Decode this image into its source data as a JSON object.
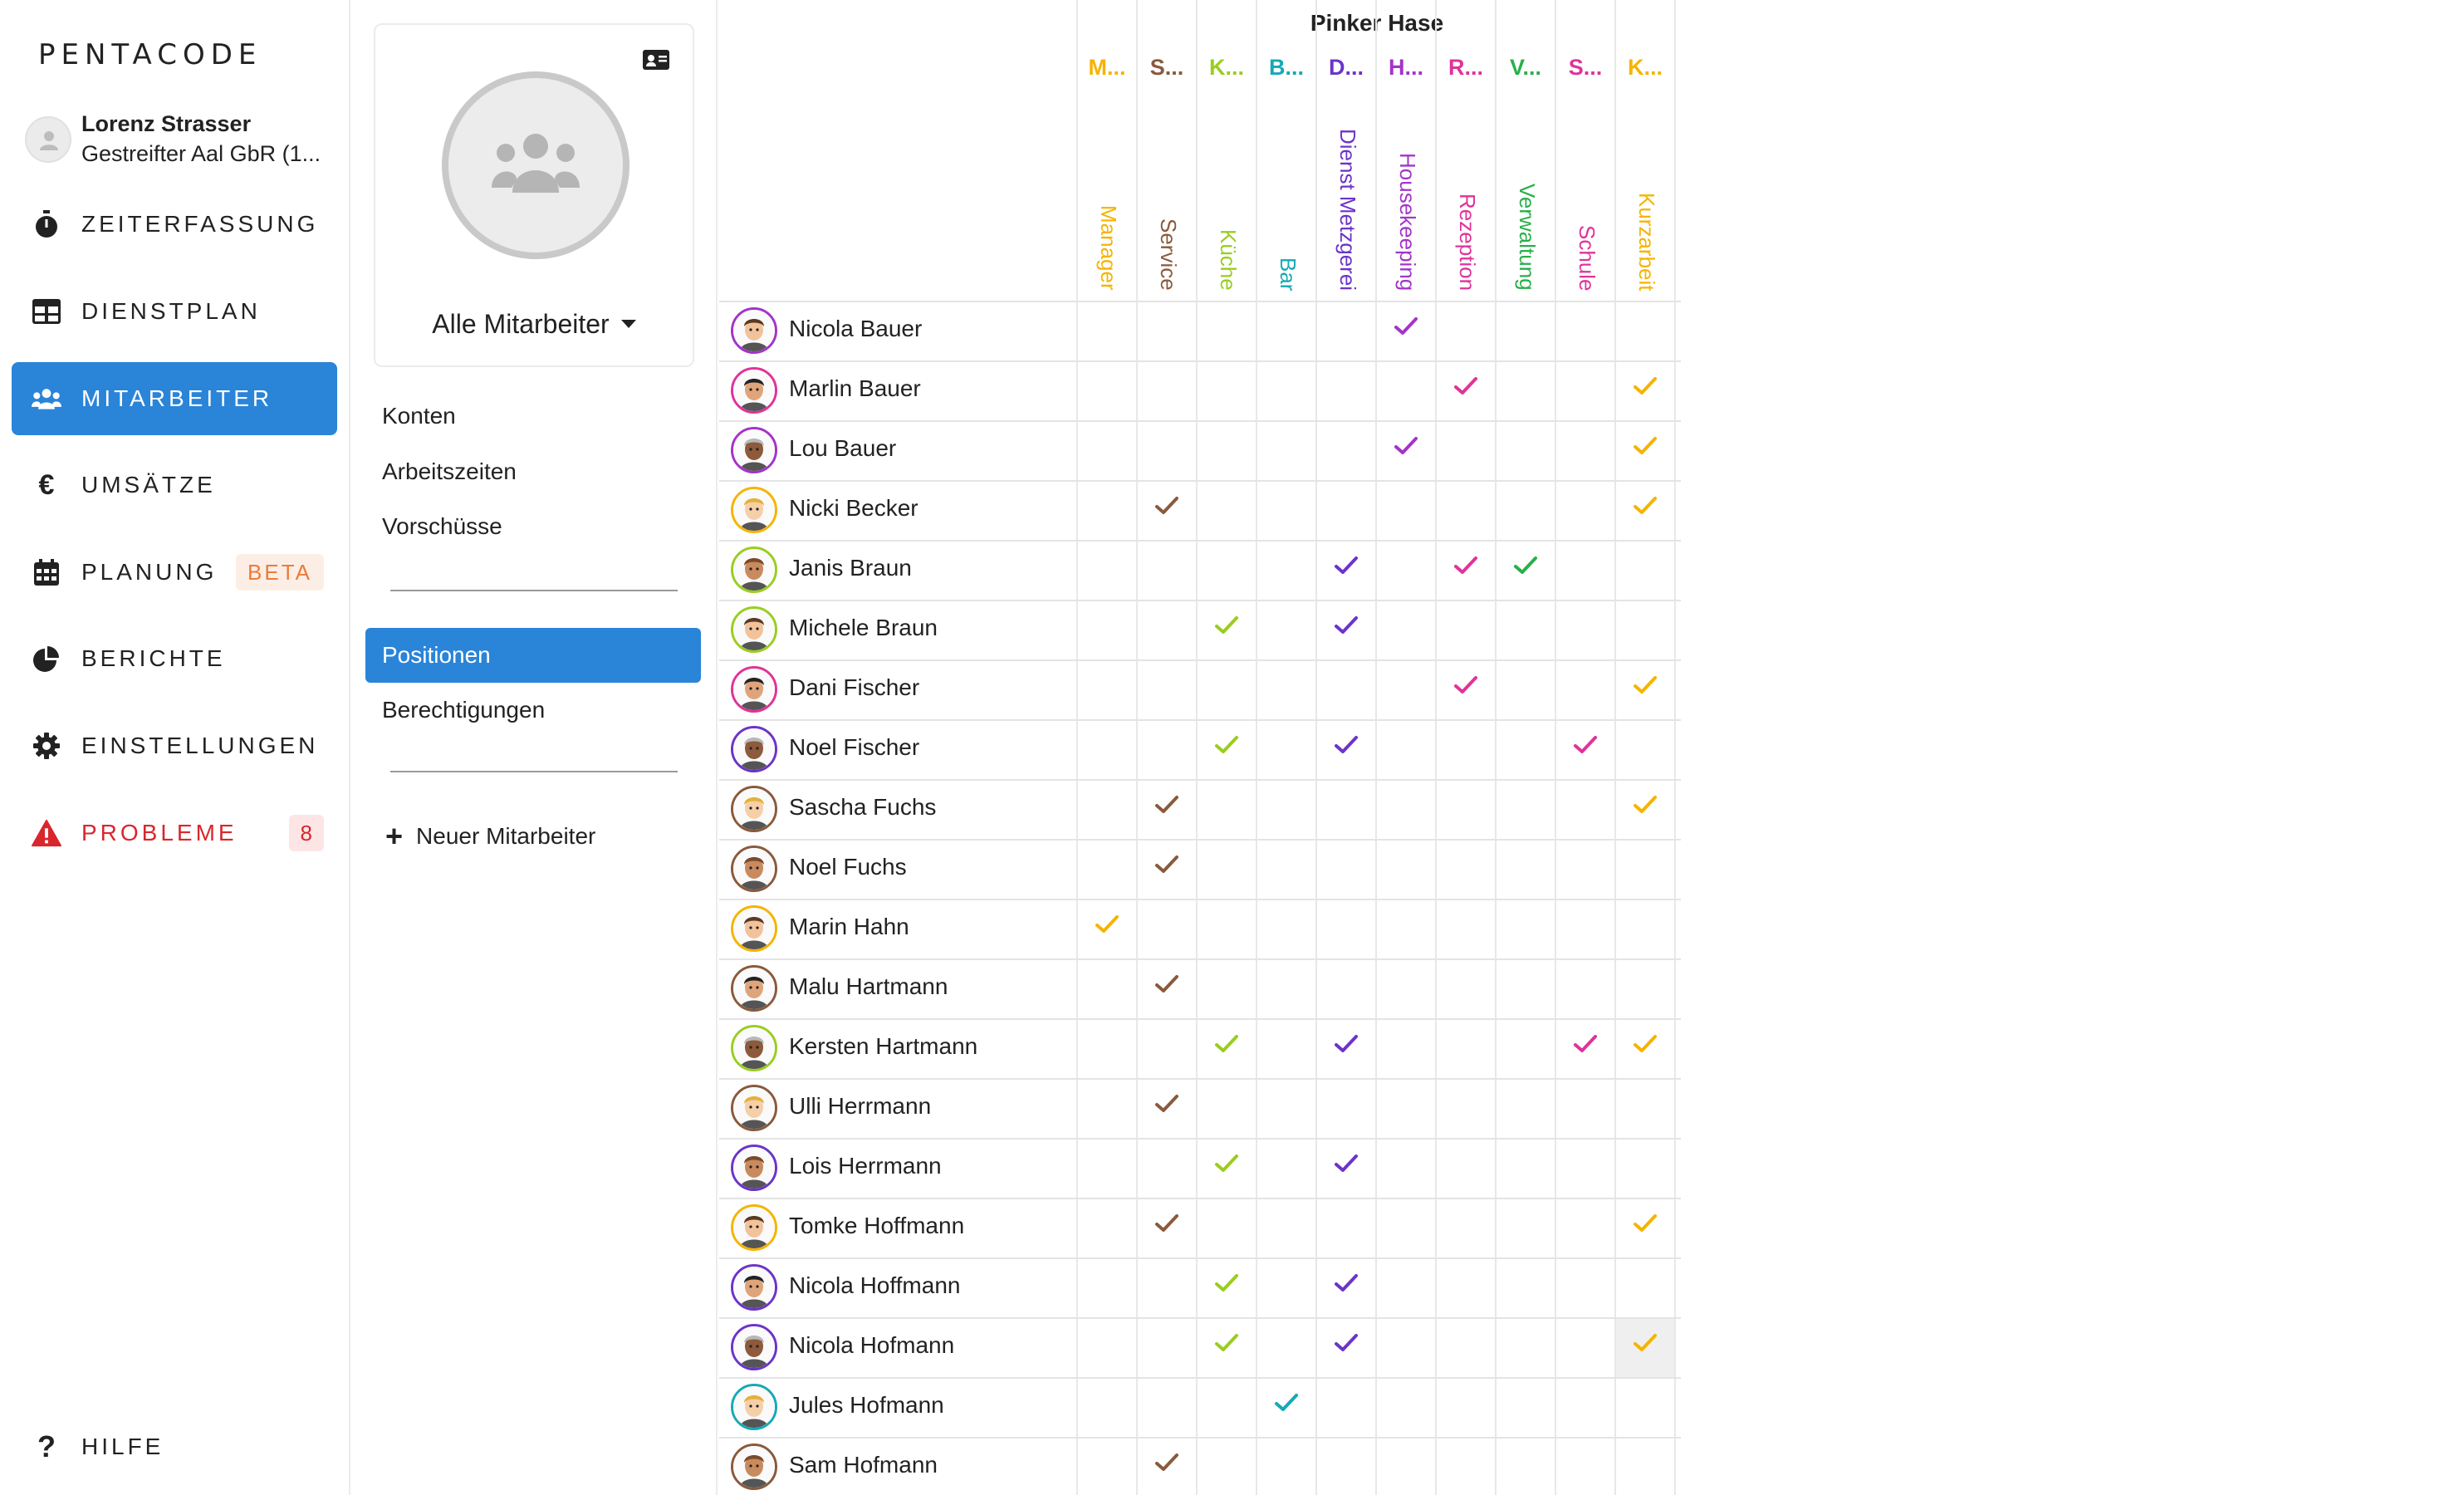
{
  "app": {
    "logo": "PENTACODE"
  },
  "user": {
    "name": "Lorenz Strasser",
    "company": "Gestreifter Aal GbR (1..."
  },
  "nav": [
    {
      "label": "Zeiterfassung",
      "icon": "stopwatch-icon",
      "active": false
    },
    {
      "label": "Dienstplan",
      "icon": "table-icon",
      "active": false
    },
    {
      "label": "Mitarbeiter",
      "icon": "users-icon",
      "active": true
    },
    {
      "label": "Umsätze",
      "icon": "euro-icon",
      "active": false
    },
    {
      "label": "Planung",
      "icon": "calendar-icon",
      "active": false,
      "badge": "BETA"
    },
    {
      "label": "Berichte",
      "icon": "pie-chart-icon",
      "active": false
    },
    {
      "label": "Einstellungen",
      "icon": "gear-icon",
      "active": false
    },
    {
      "label": "Probleme",
      "icon": "warning-icon",
      "active": false,
      "badge": "8"
    }
  ],
  "help": {
    "label": "Hilfe"
  },
  "submenu": {
    "filter_label": "Alle Mitarbeiter",
    "group1": [
      "Konten",
      "Arbeitszeiten",
      "Vorschüsse"
    ],
    "group2": [
      "Positionen",
      "Berechtigungen"
    ],
    "active": "Positionen",
    "new_employee": "Neuer Mitarbeiter"
  },
  "matrix": {
    "site": "Pinker Hase",
    "positions": [
      {
        "abbr": "M...",
        "name": "Manager",
        "color": "#f5b400"
      },
      {
        "abbr": "S...",
        "name": "Service",
        "color": "#8a5a3c"
      },
      {
        "abbr": "K...",
        "name": "Küche",
        "color": "#9acd1f"
      },
      {
        "abbr": "B...",
        "name": "Bar",
        "color": "#16a9b5"
      },
      {
        "abbr": "D...",
        "name": "Dienst Metzgerei",
        "color": "#6c34c9"
      },
      {
        "abbr": "H...",
        "name": "Housekeeping",
        "color": "#a334c9"
      },
      {
        "abbr": "R...",
        "name": "Rezeption",
        "color": "#e0339a"
      },
      {
        "abbr": "V...",
        "name": "Verwaltung",
        "color": "#28b04a"
      },
      {
        "abbr": "S...",
        "name": "Schule",
        "color": "#e0339a"
      },
      {
        "abbr": "K...",
        "name": "Kurzarbeit",
        "color": "#f5b400"
      }
    ],
    "employees": [
      {
        "name": "Nicola Bauer",
        "ring": "#a334c9",
        "checks": [
          5
        ]
      },
      {
        "name": "Marlin Bauer",
        "ring": "#e0339a",
        "checks": [
          6,
          9
        ]
      },
      {
        "name": "Lou Bauer",
        "ring": "#a334c9",
        "checks": [
          5,
          9
        ]
      },
      {
        "name": "Nicki Becker",
        "ring": "#f5b400",
        "checks": [
          1,
          9
        ]
      },
      {
        "name": "Janis Braun",
        "ring": "#9acd1f",
        "checks": [
          4,
          6,
          7
        ]
      },
      {
        "name": "Michele Braun",
        "ring": "#9acd1f",
        "checks": [
          2,
          4
        ]
      },
      {
        "name": "Dani Fischer",
        "ring": "#e0339a",
        "checks": [
          6,
          9
        ]
      },
      {
        "name": "Noel Fischer",
        "ring": "#6c34c9",
        "checks": [
          2,
          4,
          8
        ]
      },
      {
        "name": "Sascha Fuchs",
        "ring": "#8a5a3c",
        "checks": [
          1,
          9
        ]
      },
      {
        "name": "Noel Fuchs",
        "ring": "#8a5a3c",
        "checks": [
          1
        ]
      },
      {
        "name": "Marin Hahn",
        "ring": "#f5b400",
        "checks": [
          0
        ]
      },
      {
        "name": "Malu Hartmann",
        "ring": "#8a5a3c",
        "checks": [
          1
        ]
      },
      {
        "name": "Kersten Hartmann",
        "ring": "#9acd1f",
        "checks": [
          2,
          4,
          8,
          9
        ]
      },
      {
        "name": "Ulli Herrmann",
        "ring": "#8a5a3c",
        "checks": [
          1
        ]
      },
      {
        "name": "Lois Herrmann",
        "ring": "#6c34c9",
        "checks": [
          2,
          4
        ]
      },
      {
        "name": "Tomke Hoffmann",
        "ring": "#f5b400",
        "checks": [
          1,
          9
        ]
      },
      {
        "name": "Nicola Hoffmann",
        "ring": "#6c34c9",
        "checks": [
          2,
          4
        ]
      },
      {
        "name": "Nicola Hofmann",
        "ring": "#6c34c9",
        "checks": [
          2,
          4,
          9
        ],
        "highlight": 9
      },
      {
        "name": "Jules Hofmann",
        "ring": "#16a9b5",
        "checks": [
          3
        ]
      },
      {
        "name": "Sam Hofmann",
        "ring": "#8a5a3c",
        "checks": [
          1
        ]
      }
    ]
  }
}
